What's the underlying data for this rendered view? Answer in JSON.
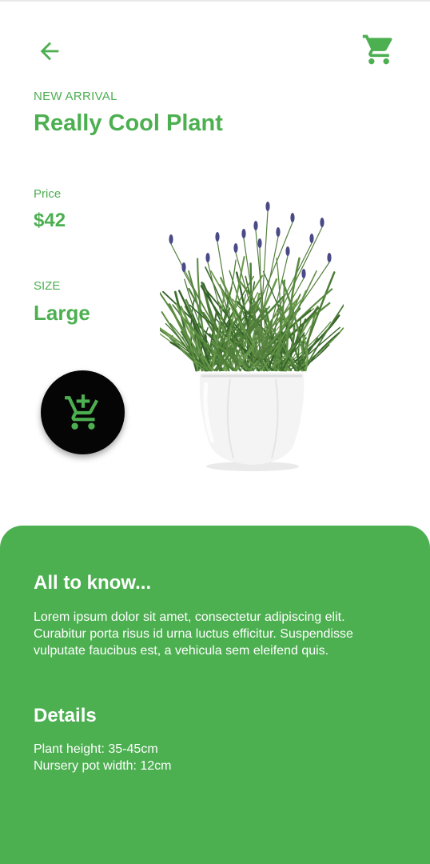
{
  "theme": {
    "accent": "#4caf50",
    "fab_background": "#050505",
    "panel_text": "#ffffff",
    "lavender_bloom": "#4a4a86",
    "pot": "#f4f4f4"
  },
  "header": {
    "back_icon": "arrow-left-icon",
    "cart_icon": "shopping-cart-icon"
  },
  "product": {
    "eyebrow": "NEW ARRIVAL",
    "title": "Really Cool Plant",
    "price_label": "Price",
    "price_value": "$42",
    "size_label": "SIZE",
    "size_value": "Large",
    "add_to_cart_icon": "add-shopping-cart-icon"
  },
  "info": {
    "about_title": "All to know...",
    "about_lines": [
      "Lorem ipsum dolor sit amet, consectetur adipiscing elit.",
      "Curabitur porta risus id urna luctus efficitur. Suspendisse",
      "vulputate faucibus est, a vehicula sem eleifend quis."
    ],
    "details_title": "Details",
    "details_lines": [
      "Plant height: 35-45cm",
      "Nursery pot width: 12cm"
    ]
  }
}
